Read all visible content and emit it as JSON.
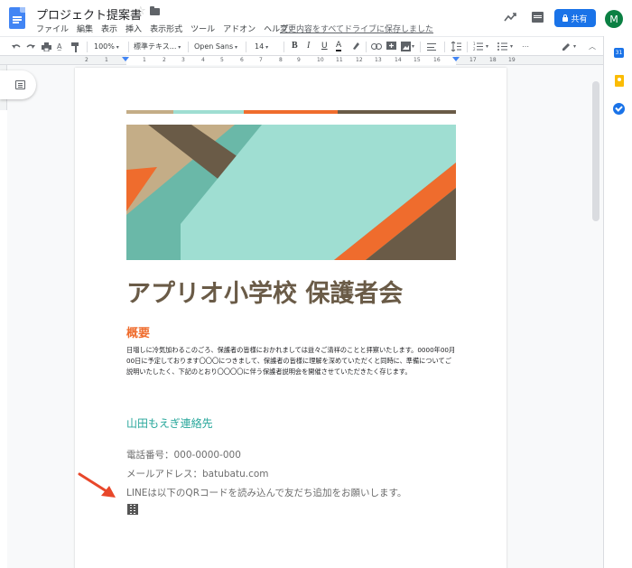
{
  "window": {
    "doc_title": "プロジェクト提案書",
    "save_status": "変更内容をすべてドライブに保存しました",
    "share_label": "共有",
    "avatar_initial": "M"
  },
  "menu": [
    "ファイル",
    "編集",
    "表示",
    "挿入",
    "表示形式",
    "ツール",
    "アドオン",
    "ヘルプ"
  ],
  "toolbar": {
    "zoom": "100%",
    "style": "標準テキス...",
    "font": "Open Sans",
    "size": "14",
    "bold": "B",
    "italic": "I",
    "underline": "U",
    "text_color": "A",
    "more": "⋯"
  },
  "ruler": {
    "numbers": [
      "2",
      "1",
      "1",
      "2",
      "3",
      "4",
      "5",
      "6",
      "7",
      "8",
      "9",
      "10",
      "11",
      "12",
      "13",
      "14",
      "15",
      "16",
      "17",
      "18",
      "19"
    ]
  },
  "side_panel": {
    "calendar": "31"
  },
  "colors": {
    "tan": "#c4ad87",
    "teal": "#9fded2",
    "orange": "#ef6c2d",
    "brown": "#6a5b47",
    "accent_blue": "#1a73e8"
  },
  "document": {
    "heading": "アプリオ小学校 保護者会",
    "section_title": "概要",
    "body": "日増しに冷気加わるこのごろ、保護者の皆様におかれましては益々ご清祥のことと拝察いたします。0000年00月00日に予定しております〇〇〇につきまして、保護者の皆様に理解を深めていただくと同時に、準備についてご説明いたしたく、下記のとおり〇〇〇〇に伴う保護者説明会を開催させていただきたく存じます。",
    "contact_title": "山田もえぎ連絡先",
    "phone": "電話番号：000-0000-000",
    "email": "メールアドレス：batubatu.com",
    "line_text": "LINEは以下のQRコードを読み込んで友だち追加をお願いします。"
  }
}
